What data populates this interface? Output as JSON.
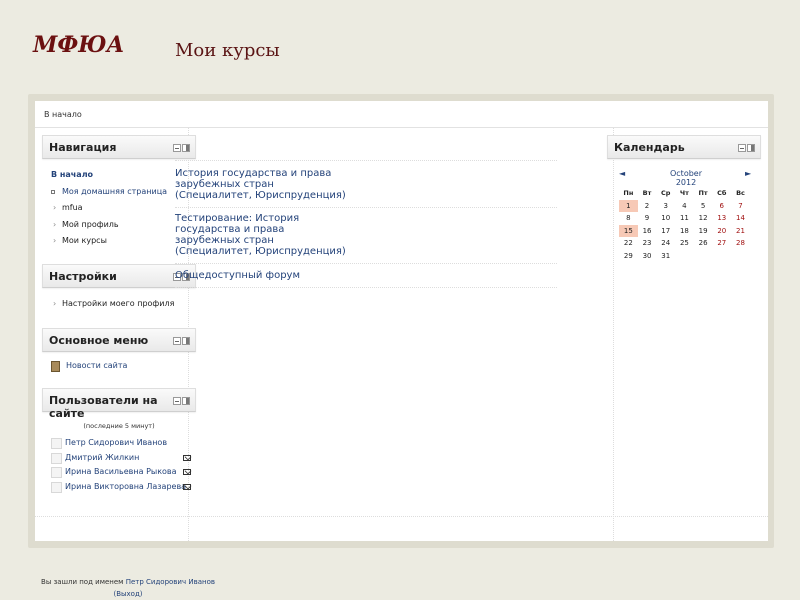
{
  "site": {
    "title": "МФЮА"
  },
  "breadcrumb": {
    "home": "В начало"
  },
  "navigation": {
    "title": "Навигация",
    "home": "В начало",
    "items": [
      "Моя домашняя страница",
      "mfua",
      "Мой профиль",
      "Мои курсы"
    ]
  },
  "settings": {
    "title": "Настройки",
    "items": [
      "Настройки моего профиля"
    ]
  },
  "main_menu": {
    "title": "Основное меню",
    "items": [
      "Новости сайта"
    ]
  },
  "online_users": {
    "title": "Пользователи на сайте",
    "note": "(последние 5 минут)",
    "users": [
      {
        "name": "Петр Сидорович Иванов",
        "message": false
      },
      {
        "name": "Дмитрий Жилкин",
        "message": true
      },
      {
        "name": "Ирина Васильевна Рыкова",
        "message": true
      },
      {
        "name": "Ирина Викторовна Лазарева",
        "message": true
      }
    ]
  },
  "main": {
    "title": "Мои курсы",
    "courses": [
      {
        "lines": [
          "История государства и права",
          "зарубежных стран",
          "(Специалитет, Юриспруденция)"
        ]
      },
      {
        "lines": [
          "Тестирование: История",
          "государства и права",
          "зарубежных стран",
          "(Специалитет, Юриспруденция)"
        ]
      },
      {
        "lines": [
          "Общедоступный форум"
        ]
      }
    ]
  },
  "calendar": {
    "title": "Календарь",
    "month": "October 2012",
    "prev_icon": "◄",
    "next_icon": "►",
    "weekdays": [
      "Пн",
      "Вт",
      "Ср",
      "Чт",
      "Пт",
      "Сб",
      "Вс"
    ],
    "weeks": [
      [
        "1",
        "2",
        "3",
        "4",
        "5",
        "6",
        "7"
      ],
      [
        "8",
        "9",
        "10",
        "11",
        "12",
        "13",
        "14"
      ],
      [
        "15",
        "16",
        "17",
        "18",
        "19",
        "20",
        "21"
      ],
      [
        "22",
        "23",
        "24",
        "25",
        "26",
        "27",
        "28"
      ],
      [
        "29",
        "30",
        "31",
        "",
        "",
        "",
        ""
      ]
    ],
    "highlighted": [
      "1",
      "15"
    ],
    "weekend_color": "#a01010",
    "highlight_color": "#f7c9b6"
  },
  "footer": {
    "logged_in_prefix": "Вы зашли под именем",
    "user": "Петр Сидорович Иванов",
    "logout": "(Выход)"
  }
}
